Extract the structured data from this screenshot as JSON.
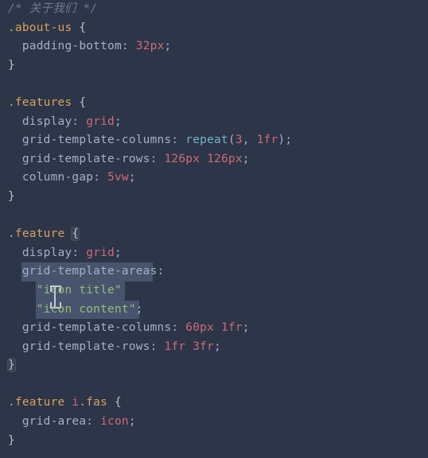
{
  "chart_data": {
    "type": "table",
    "title": "CSS rules visible in editor",
    "rules": [
      {
        "comment": "/* 关于我们 */"
      },
      {
        "selector": ".about-us",
        "declarations": [
          {
            "property": "padding-bottom",
            "value": "32px"
          }
        ]
      },
      {
        "selector": ".features",
        "declarations": [
          {
            "property": "display",
            "value": "grid"
          },
          {
            "property": "grid-template-columns",
            "value": "repeat(3, 1fr)"
          },
          {
            "property": "grid-template-rows",
            "value": "126px 126px"
          },
          {
            "property": "column-gap",
            "value": "5vw"
          }
        ]
      },
      {
        "selector": ".feature",
        "declarations": [
          {
            "property": "display",
            "value": "grid"
          },
          {
            "property": "grid-template-areas",
            "value": "\"icon title\" \"icon content\""
          },
          {
            "property": "grid-template-columns",
            "value": "60px 1fr"
          },
          {
            "property": "grid-template-rows",
            "value": "1fr 3fr"
          }
        ]
      },
      {
        "selector": ".feature i.fas",
        "declarations": [
          {
            "property": "grid-area",
            "value": "icon"
          }
        ]
      }
    ]
  },
  "cursor": {
    "line_index": 15,
    "column_chars": 7,
    "selection": "grid-template-areas: \"icon title\" \"icon content\""
  },
  "t": {
    "comment_open": "/* ",
    "comment_text": "关于我们",
    "comment_close": " */",
    "sel_about": ".about-us",
    "sel_features": ".features",
    "sel_feature": ".feature",
    "sel_feature_ifas_cls": ".feature ",
    "sel_feature_ifas_el": "i",
    "sel_feature_ifas_fas": ".fas",
    "p_padding_bottom": "padding-bottom",
    "v_32px": "32px",
    "p_display": "display",
    "v_grid": "grid",
    "p_gtc": "grid-template-columns",
    "fn_repeat": "repeat",
    "n_3": "3",
    "v_1fr": "1fr",
    "p_gtr": "grid-template-rows",
    "v_126px_a": "126px",
    "v_126px_b": "126px",
    "p_colgap": "column-gap",
    "v_5vw": "5vw",
    "p_gta": "grid-template-areas",
    "s_icon_title": "\"icon title\"",
    "s_icon_content": "\"icon content\"",
    "v_60px": "60px",
    "v_1fr_b": "1fr",
    "v_1fr_c": "1fr",
    "v_3fr": "3fr",
    "p_gridarea": "grid-area",
    "v_icon": "icon",
    "brace_open": "{",
    "brace_close": "}",
    "colon": ":",
    "semi": ";",
    "comma": ", ",
    "paren_open": "(",
    "paren_close": ")",
    "sp": " ",
    "sp2": "  ",
    "sp4": "    "
  }
}
